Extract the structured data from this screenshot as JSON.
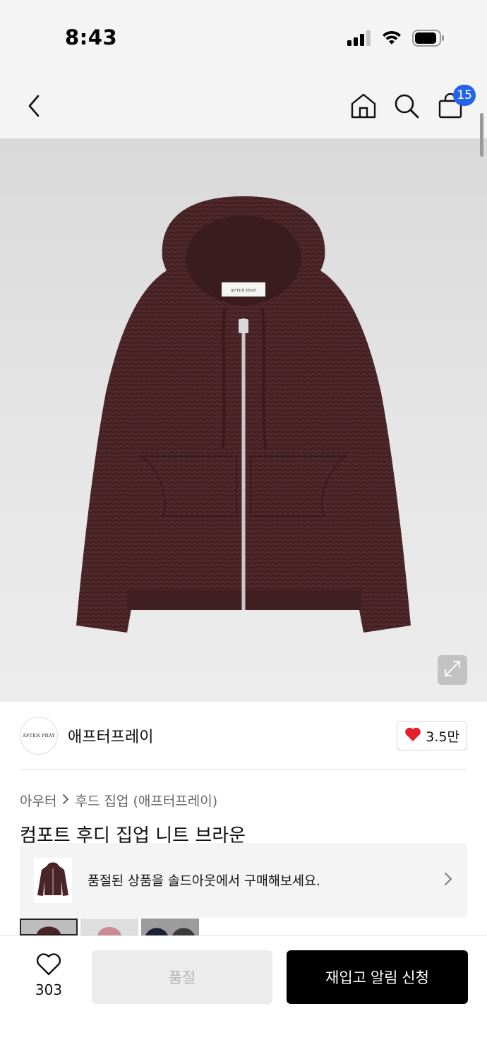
{
  "status_bar": {
    "time": "8:43",
    "icons": [
      "cellular-signal-icon",
      "wifi-icon",
      "battery-icon"
    ]
  },
  "nav": {
    "back_icon": "chevron-left-icon",
    "home_icon": "home-icon",
    "search_icon": "search-icon",
    "cart_icon": "shopping-bag-icon",
    "cart_count": "15"
  },
  "product_image": {
    "label_text": "AFTER PRAY",
    "expand_icon": "expand-icon"
  },
  "brand": {
    "logo_text": "AFTER PRAY",
    "name": "애프터프레이",
    "like_icon": "heart-filled-icon",
    "like_count": "3.5만"
  },
  "breadcrumb": {
    "items": [
      "아우터",
      "후드 집업 (애프터프레이)"
    ]
  },
  "product": {
    "title": "컴포트 후디 집업 니트 브라운"
  },
  "soldout_banner": {
    "text": "품절된 상품을 솔드아웃에서 구매해보세요."
  },
  "bottom_bar": {
    "wish_count": "303",
    "soldout_label": "품절",
    "restock_label": "재입고 알림 신청"
  },
  "colors": {
    "accent_blue": "#2563eb",
    "heart_red": "#e5202a",
    "sweater_brown": "#4a2528",
    "primary_button": "#000000"
  }
}
